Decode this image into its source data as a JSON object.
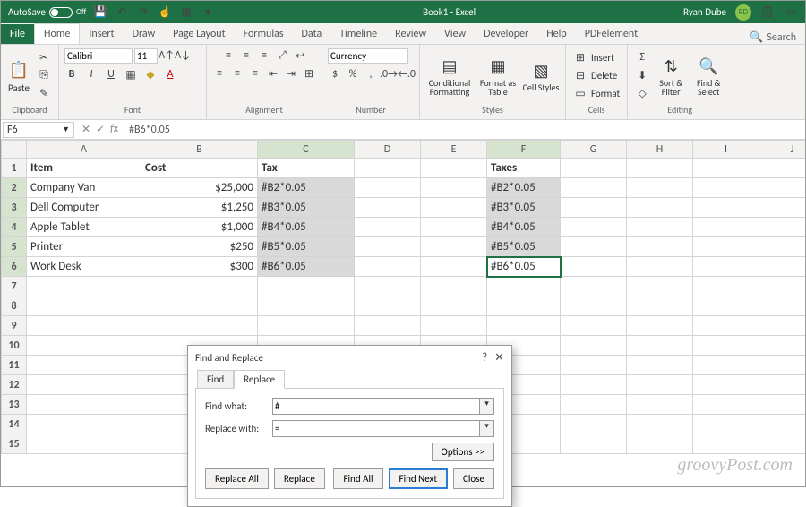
{
  "titlebar": {
    "autosave": "AutoSave",
    "autosave_state": "Off",
    "doc": "Book1 - Excel",
    "user": "Ryan Dube",
    "initials": "RD"
  },
  "tabs": {
    "file": "File",
    "home": "Home",
    "insert": "Insert",
    "draw": "Draw",
    "pagelayout": "Page Layout",
    "formulas": "Formulas",
    "data": "Data",
    "timeline": "Timeline",
    "review": "Review",
    "view": "View",
    "developer": "Developer",
    "help": "Help",
    "pdfelement": "PDFelement",
    "search": "Search"
  },
  "ribbon": {
    "clipboard": {
      "label": "Clipboard",
      "paste": "Paste"
    },
    "font": {
      "label": "Font",
      "name": "Calibri",
      "size": "11"
    },
    "alignment": {
      "label": "Alignment"
    },
    "number": {
      "label": "Number",
      "format": "Currency"
    },
    "styles": {
      "label": "Styles",
      "cond": "Conditional Formatting",
      "table": "Format as Table",
      "cell": "Cell Styles"
    },
    "cells": {
      "label": "Cells",
      "insert": "Insert",
      "delete": "Delete",
      "format": "Format"
    },
    "editing": {
      "label": "Editing",
      "sort": "Sort & Filter",
      "find": "Find & Select"
    }
  },
  "formulabar": {
    "cellref": "F6",
    "formula": "#B6*0.05"
  },
  "columns": [
    "A",
    "B",
    "C",
    "D",
    "E",
    "F",
    "G",
    "H",
    "I",
    "J"
  ],
  "rows": [
    {
      "n": "1",
      "A": "Item",
      "B": "Cost",
      "C": "Tax",
      "F": "Taxes",
      "bold": true
    },
    {
      "n": "2",
      "A": "Company Van",
      "B": "$25,000",
      "C": "#B2*0.05",
      "F": "#B2*0.05"
    },
    {
      "n": "3",
      "A": "Dell Computer",
      "B": "$1,250",
      "C": "#B3*0.05",
      "F": "#B3*0.05"
    },
    {
      "n": "4",
      "A": "Apple Tablet",
      "B": "$1,000",
      "C": "#B4*0.05",
      "F": "#B4*0.05"
    },
    {
      "n": "5",
      "A": "Printer",
      "B": "$250",
      "C": "#B5*0.05",
      "F": "#B5*0.05"
    },
    {
      "n": "6",
      "A": "Work Desk",
      "B": "$300",
      "C": "#B6*0.05",
      "F": "#B6*0.05"
    },
    {
      "n": "7"
    },
    {
      "n": "8"
    },
    {
      "n": "9"
    },
    {
      "n": "10"
    },
    {
      "n": "11"
    },
    {
      "n": "12"
    },
    {
      "n": "13"
    },
    {
      "n": "14"
    },
    {
      "n": "15"
    }
  ],
  "dialog": {
    "title": "Find and Replace",
    "tab_find": "Find",
    "tab_replace": "Replace",
    "find_label": "Find what:",
    "find_value": "#",
    "replace_label": "Replace with:",
    "replace_value": "=",
    "options": "Options >>",
    "replace_all": "Replace All",
    "replace": "Replace",
    "find_all": "Find All",
    "find_next": "Find Next",
    "close": "Close"
  },
  "watermark": "groovyPost.com"
}
